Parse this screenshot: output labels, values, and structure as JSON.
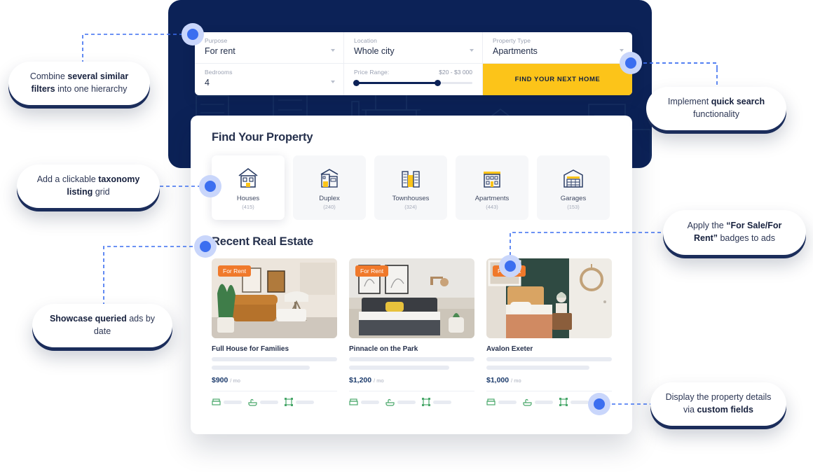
{
  "search_bar": {
    "fields": [
      {
        "label": "Purpose",
        "value": "For rent",
        "name": "purpose"
      },
      {
        "label": "Location",
        "value": "Whole city",
        "name": "location"
      },
      {
        "label": "Property Type",
        "value": "Apartments",
        "name": "property-type"
      },
      {
        "label": "Bedrooms",
        "value": "4",
        "name": "bedrooms"
      }
    ],
    "price_range": {
      "label": "Price Range:",
      "value": "$20 - $3 000"
    },
    "submit_label": "FIND YOUR NEXT HOME",
    "accent_yellow": "#fcc419",
    "panel_navy": "#0c2257"
  },
  "find_property": {
    "title": "Find Your Property",
    "items": [
      {
        "label": "Houses",
        "count": "(415)",
        "icon": "house-icon",
        "active": true
      },
      {
        "label": "Duplex",
        "count": "(240)",
        "icon": "duplex-icon",
        "active": false
      },
      {
        "label": "Townhouses",
        "count": "(324)",
        "icon": "townhouse-icon",
        "active": false
      },
      {
        "label": "Apartments",
        "count": "(443)",
        "icon": "apartment-icon",
        "active": false
      },
      {
        "label": "Garages",
        "count": "(153)",
        "icon": "garage-icon",
        "active": false
      }
    ]
  },
  "recent": {
    "title": "Recent Real Estate",
    "badge_color": "#f0792b",
    "listings": [
      {
        "badge": "For Rent",
        "title": "Full House for Families",
        "price": "$900",
        "period": "/ mo",
        "image": "living-room-photo"
      },
      {
        "badge": "For Rent",
        "title": "Pinnacle on the Park",
        "price": "$1,200",
        "period": "/ mo",
        "image": "bedroom-photo"
      },
      {
        "badge": "For Rent",
        "title": "Avalon Exeter",
        "price": "$1,000",
        "period": "/ mo",
        "image": "green-bedroom-photo"
      }
    ],
    "meta_icons": [
      "bed-icon",
      "bath-icon",
      "area-icon"
    ]
  },
  "callouts": [
    {
      "name": "filters-hierarchy",
      "pre": "Combine ",
      "bold": "several similar filters",
      "post": " into one hierarchy"
    },
    {
      "name": "taxonomy-grid",
      "pre": "Add a clickable ",
      "bold": "taxonomy listing",
      "post": " grid"
    },
    {
      "name": "queried-ads",
      "pre": "",
      "bold": "Showcase queried",
      "post": " ads by date"
    },
    {
      "name": "quick-search",
      "pre": "Implement ",
      "bold": "quick search",
      "post": " functionality"
    },
    {
      "name": "rent-badges",
      "pre": "Apply the ",
      "bold": "“For Sale/For Rent”",
      "post": " badges to ads"
    },
    {
      "name": "custom-fields",
      "pre": "Display the property details via ",
      "bold": "custom fields",
      "post": ""
    }
  ],
  "connector_color": "#3b6ef0"
}
